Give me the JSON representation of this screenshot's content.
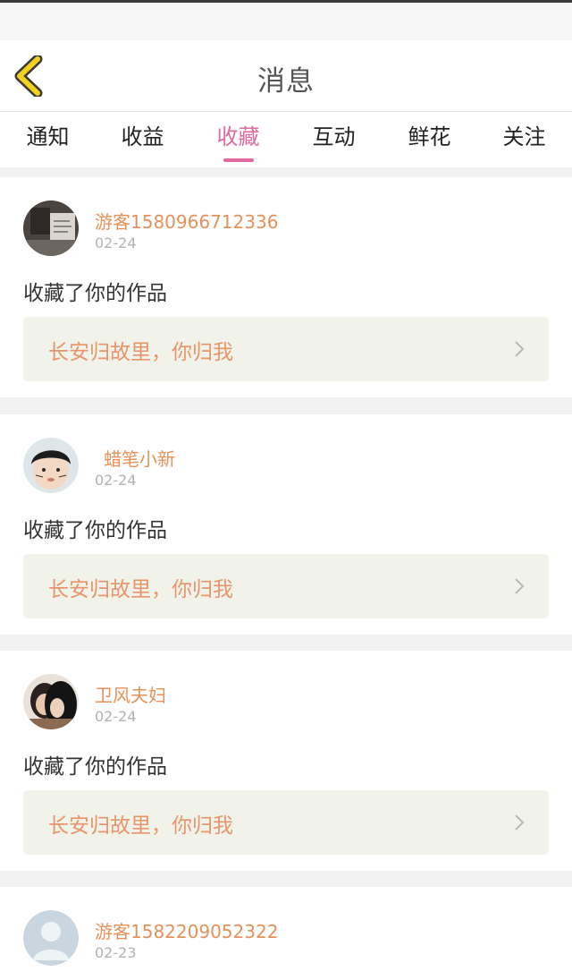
{
  "header": {
    "title": "消息",
    "back_icon": "chevron-left-icon"
  },
  "tabs": [
    {
      "label": "通知",
      "active": false
    },
    {
      "label": "收益",
      "active": false
    },
    {
      "label": "收藏",
      "active": true
    },
    {
      "label": "互动",
      "active": false
    },
    {
      "label": "鲜花",
      "active": false
    },
    {
      "label": "关注",
      "active": false
    }
  ],
  "messages": [
    {
      "username": "游客1580966712336",
      "date": "02-24",
      "action": "收藏了你的作品",
      "work_title": "长安归故里，你归我"
    },
    {
      "username": "蜡笔小新",
      "date": "02-24",
      "action": "收藏了你的作品",
      "work_title": "长安归故里，你归我"
    },
    {
      "username": "卫风夫妇",
      "date": "02-24",
      "action": "收藏了你的作品",
      "work_title": "长安归故里，你归我"
    },
    {
      "username": "游客1582209052322",
      "date": "02-23"
    }
  ],
  "colors": {
    "accent": "#e06aa0",
    "username": "#e6915a",
    "work_title": "#e8956b",
    "work_bg": "#f1f3ea",
    "back_icon": "#f2d21c"
  }
}
